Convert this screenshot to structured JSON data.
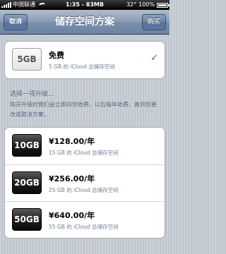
{
  "status_bar": {
    "carrier": "中国联通",
    "time": "1:35 - 83MB",
    "temperature": "32°",
    "battery": "100%"
  },
  "nav": {
    "cancel_label": "取消",
    "title": "储存空间方案",
    "buy_label": "购买"
  },
  "current_plan": {
    "badge": "5GB",
    "name": "免费",
    "desc": "5 GB 的 iCloud 总储存空间",
    "selected_icon": "checkmark-icon",
    "check_glyph": "✓"
  },
  "upgrade": {
    "label": "选择一项升级...",
    "note": "购买升级时我们会立即向您收费，以后每年收费，直到您更改或取消方案。",
    "plans": [
      {
        "badge": "10GB",
        "price": "¥128.00/年",
        "desc": "15 GB 的 iCloud 总储存空间"
      },
      {
        "badge": "20GB",
        "price": "¥256.00/年",
        "desc": "25 GB 的 iCloud 总储存空间"
      },
      {
        "badge": "50GB",
        "price": "¥640.00/年",
        "desc": "55 GB 的 iCloud 总储存空间"
      }
    ]
  },
  "colors": {
    "nav_bar": "#7990ad",
    "check": "#3c5d90",
    "background": "#c5ccd4"
  }
}
